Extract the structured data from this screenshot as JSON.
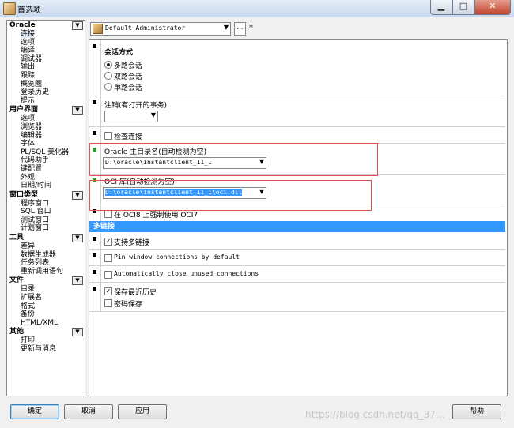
{
  "window": {
    "title": "首选项"
  },
  "tree": {
    "categories": [
      {
        "label": "Oracle",
        "items": [
          "连接",
          "选项",
          "编译",
          "调试器",
          "输出",
          "跟踪",
          "概览图",
          "登录历史",
          "提示"
        ]
      },
      {
        "label": "用户界面",
        "items": [
          "选项",
          "浏览器",
          "编辑器",
          "字体",
          "PL/SQL 美化器",
          "代码助手",
          "键配置",
          "外观",
          "日期/时间"
        ]
      },
      {
        "label": "窗口类型",
        "items": [
          "程序窗口",
          "SQL 窗口",
          "测试窗口",
          "计划窗口"
        ]
      },
      {
        "label": "工具",
        "items": [
          "差异",
          "数据生成器",
          "任务列表",
          "重新调用语句"
        ]
      },
      {
        "label": "文件",
        "items": [
          "目录",
          "扩展名",
          "格式",
          "备份",
          "HTML/XML"
        ]
      },
      {
        "label": "其他",
        "items": [
          "打印",
          "更新与消息"
        ]
      }
    ],
    "toggle_icon": "▼"
  },
  "profile": {
    "value": "Default Administrator",
    "more": "...",
    "star": "*"
  },
  "sections": {
    "session_mode": {
      "title": "会话方式",
      "options": [
        "多路会话",
        "双路会话",
        "单路会话"
      ],
      "selected": 0
    },
    "logoff": {
      "title": "注销(有打开的事务)",
      "value": ""
    },
    "check_connection": {
      "label": "检查连接"
    },
    "oracle_home": {
      "title": "Oracle 主目录名(自动检测为空)",
      "value": "D:\\oracle\\instantclient_11_1"
    },
    "oci_library": {
      "title": "OCI 库(自动检测为空)",
      "value": "D:\\oracle\\instantclient_11_1\\oci.dll"
    },
    "force_oci7": {
      "label": "在 OCI8 上强制使用 OCI7"
    },
    "multi_session_banner": "多链接",
    "support_multi": {
      "label": "支持多链接",
      "checked": true
    },
    "pin_window": {
      "label": "Pin window connections by default",
      "checked": false
    },
    "auto_close": {
      "label": "Automatically close unused connections",
      "checked": false
    },
    "save_history": {
      "label": "保存最近历史",
      "checked": true
    },
    "save_password": {
      "label": "密码保存",
      "checked": false
    }
  },
  "buttons": {
    "ok": "确定",
    "cancel": "取消",
    "apply": "应用",
    "help": "帮助"
  },
  "watermark": "https://blog.csdn.net/qq_37..."
}
